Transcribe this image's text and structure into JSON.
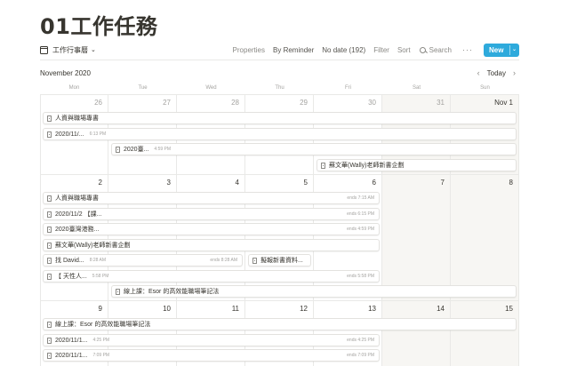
{
  "page": {
    "title": "01工作任務"
  },
  "toolbar": {
    "view_label": "工作行事曆",
    "view_chevron": "⌄",
    "properties": "Properties",
    "by_reminder": "By Reminder",
    "no_date": "No date (192)",
    "filter": "Filter",
    "sort": "Sort",
    "search": "Search",
    "more": "···",
    "new_label": "New",
    "new_chevron": "⌄",
    "accent_color": "#2eaadc"
  },
  "calendar": {
    "month": "November 2020",
    "prev": "‹",
    "today": "Today",
    "next": "›",
    "weekdays": [
      "Mon",
      "Tue",
      "Wed",
      "Thu",
      "Fri",
      "Sat",
      "Sun"
    ],
    "weeks": [
      {
        "days": [
          "26",
          "27",
          "28",
          "29",
          "30",
          "31",
          "Nov 1"
        ]
      },
      {
        "days": [
          "2",
          "3",
          "4",
          "5",
          "6",
          "7",
          "8"
        ]
      },
      {
        "days": [
          "9",
          "10",
          "11",
          "12",
          "13",
          "14",
          "15"
        ]
      }
    ],
    "events": {
      "w1e1": {
        "title": "人資與職場專書"
      },
      "w1e2": {
        "title": "2020/11/...",
        "time": "6:13 PM"
      },
      "w1e3": {
        "title": "2020臺...",
        "time": "4:59 PM"
      },
      "w1e4": {
        "title": "蘇文華(Wally)老師新書企劃"
      },
      "w2e1": {
        "title": "人資與職場專書",
        "ends": "ends 7:15 AM"
      },
      "w2e2": {
        "title": "2020/11/2 【課...",
        "ends": "ends 6:15 PM"
      },
      "w2e3": {
        "title": "2020臺灣港務...",
        "ends": "ends 4:59 PM"
      },
      "w2e4": {
        "title": "蘇文華(Wally)老師新書企劃"
      },
      "w2e5": {
        "title": "找 David...",
        "time": "8:28 AM",
        "ends": "ends 8:28 AM"
      },
      "w2e6": {
        "title": "擬報新書資料..."
      },
      "w2e7": {
        "title": "【 天性人...",
        "time": "5:58 PM",
        "ends": "ends 5:58 PM"
      },
      "w2e8": {
        "title": "線上課：Esor 的高效能職場筆記法"
      },
      "w3e1": {
        "title": "線上課：Esor 的高效能職場筆記法"
      },
      "w3e2": {
        "title": "2020/11/1...",
        "time": "4:25 PM",
        "ends": "ends 4:25 PM"
      },
      "w3e3": {
        "title": "2020/11/1...",
        "time": "7:09 PM",
        "ends": "ends 7:09 PM"
      }
    }
  }
}
